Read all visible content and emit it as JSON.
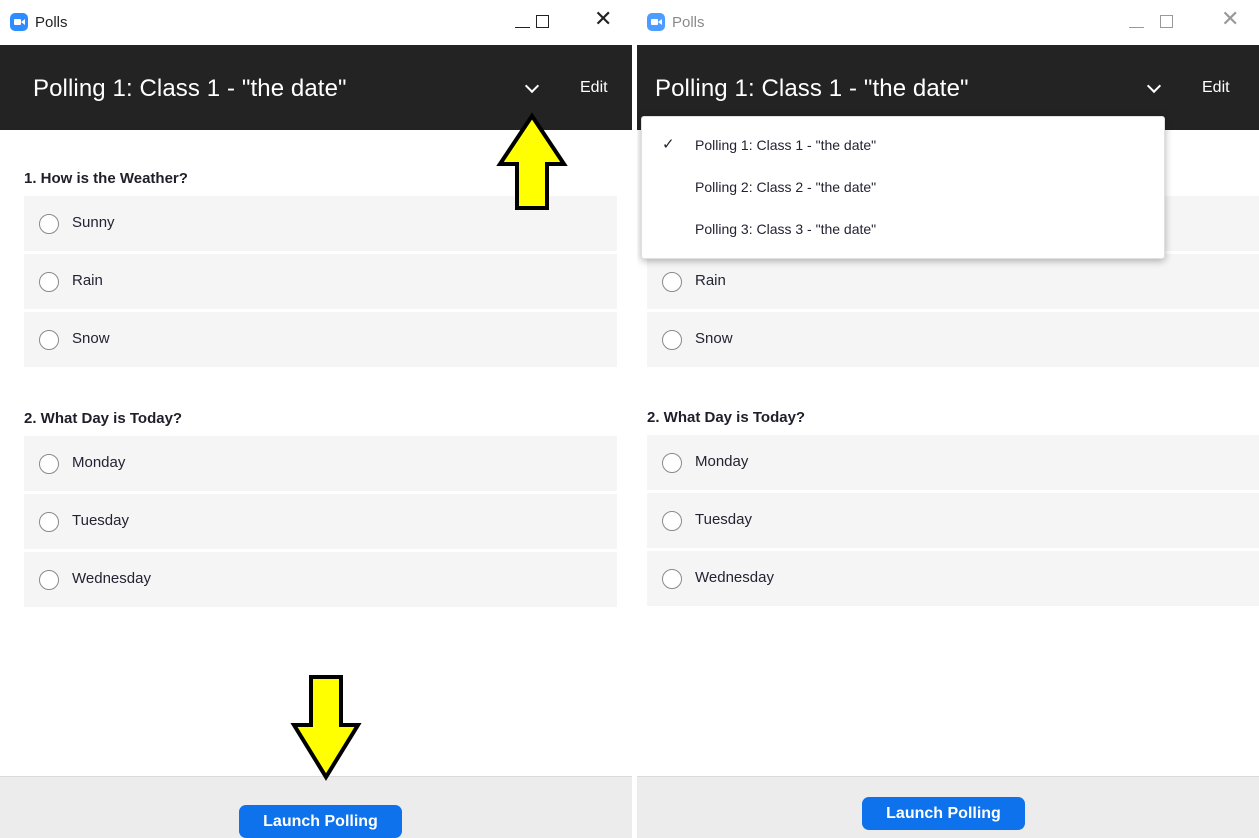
{
  "left_window": {
    "title": "Polls",
    "poll_title": "Polling 1: Class 1 - \"the date\"",
    "edit_label": "Edit",
    "questions": [
      {
        "label": "1. How is the Weather?",
        "options": [
          "Sunny",
          "Rain",
          "Snow"
        ]
      },
      {
        "label": "2. What Day is Today?",
        "options": [
          "Monday",
          "Tuesday",
          "Wednesday"
        ]
      }
    ],
    "launch_label": "Launch Polling"
  },
  "right_window": {
    "title": "Polls",
    "poll_title": "Polling 1: Class 1 - \"the date\"",
    "edit_label": "Edit",
    "dropdown": {
      "items": [
        {
          "label": "Polling 1: Class 1 - \"the date\"",
          "selected": true
        },
        {
          "label": "Polling 2: Class 2 - \"the date\"",
          "selected": false
        },
        {
          "label": "Polling 3: Class 3 - \"the date\"",
          "selected": false
        }
      ]
    },
    "questions": [
      {
        "label": "2. What Day is Today?",
        "options": [
          "Monday",
          "Tuesday",
          "Wednesday"
        ]
      }
    ],
    "visible_q1_options": [
      "Rain",
      "Snow"
    ],
    "launch_label": "Launch Polling"
  },
  "icons": {
    "app": "zoom-logo-icon",
    "minimize": "minimize-icon",
    "maximize": "maximize-icon",
    "close": "close-icon",
    "dropdown": "chevron-down-icon",
    "check": "checkmark-icon",
    "annotation": "yellow-arrow-icon"
  },
  "colors": {
    "header_bg": "#232323",
    "button_blue": "#0e72ed",
    "logo_blue": "#2d8cff",
    "arrow_yellow": "#ffff00"
  }
}
